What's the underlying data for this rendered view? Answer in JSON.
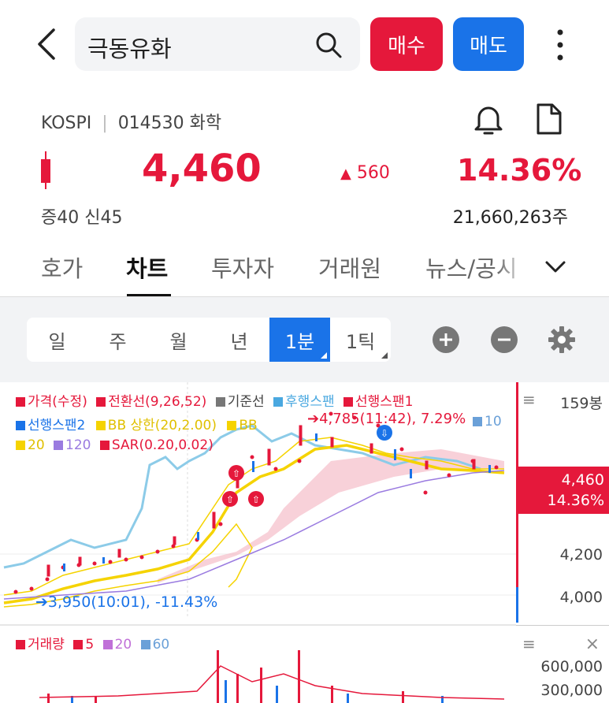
{
  "header": {
    "stock_name": "극동유화",
    "buy_label": "매수",
    "sell_label": "매도"
  },
  "info": {
    "market": "KOSPI",
    "code_sector": "014530 화학",
    "price": "4,460",
    "change": "560",
    "change_pct": "14.36%",
    "margin": "증40 신45",
    "volume": "21,660,263주"
  },
  "tabs": [
    "호가",
    "차트",
    "투자자",
    "거래원",
    "뉴스/공시"
  ],
  "periods": [
    "일",
    "주",
    "월",
    "년",
    "1분",
    "1틱"
  ],
  "legend": {
    "price": "가격(수정)",
    "conversion": "전환선(9,26,52)",
    "base": "기준선",
    "lagging": "후행스팬",
    "lead1": "선행스팬1",
    "lead2": "선행스팬2",
    "bb_upper": "BB 상한(20,2.00)",
    "bb_mid": "BB",
    "ma20": "20",
    "ma120": "120",
    "sar": "SAR(0.20,0.02)",
    "ma10": "10"
  },
  "annotations": {
    "high": "4,785(11:42), 7.29%",
    "low": "3,950(10:01), -11.43%"
  },
  "axis": {
    "count": "159봉",
    "tag_price": "4,460",
    "tag_pct": "14.36%",
    "y1": "4,200",
    "y2": "4,000",
    "vol1": "600,000",
    "vol2": "300,000"
  },
  "volume_legend": {
    "label": "거래량",
    "ma5": "5",
    "ma20": "20",
    "ma60": "60"
  },
  "colors": {
    "up": "#e5183b",
    "down": "#1a73e8"
  }
}
